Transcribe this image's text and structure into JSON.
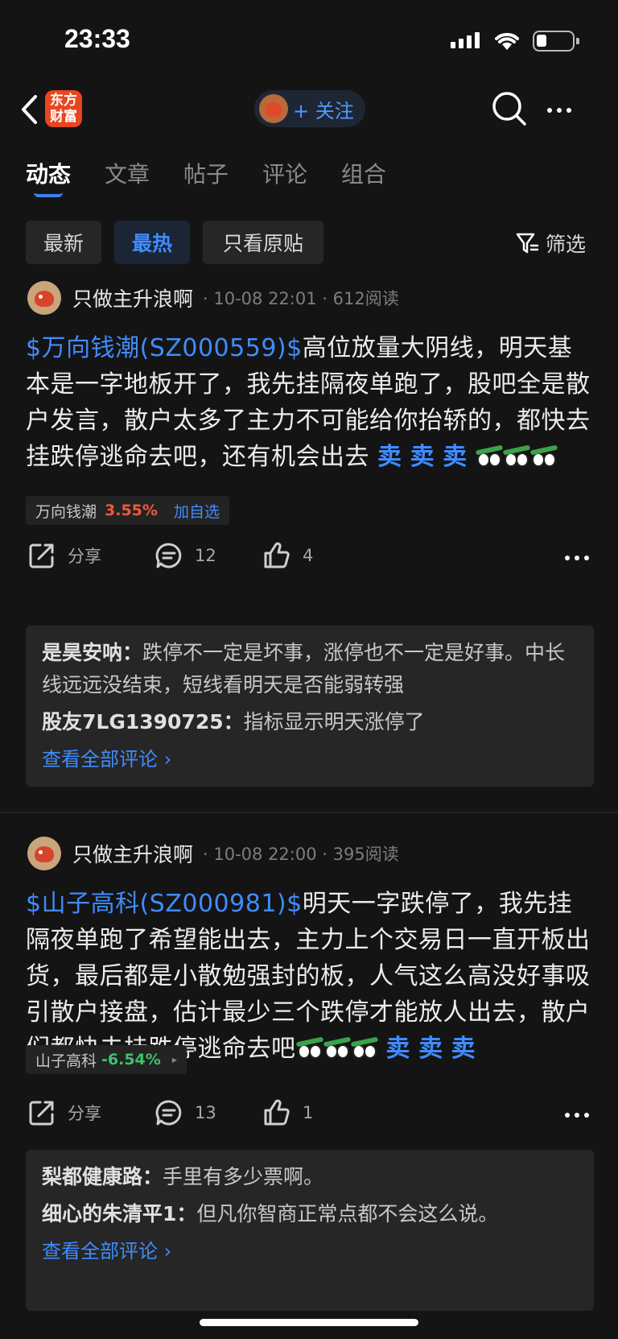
{
  "status": {
    "time": "23:33"
  },
  "nav": {
    "logo_line1": "东方",
    "logo_line2": "财富",
    "follow_label": "+ 关注"
  },
  "tabs": [
    "动态",
    "文章",
    "帖子",
    "评论",
    "组合"
  ],
  "filters": {
    "chips": [
      "最新",
      "最热",
      "只看原贴"
    ],
    "filter_label": "筛选"
  },
  "posts": [
    {
      "author": "只做主升浪啊",
      "time": "10-08 22:01",
      "reads": "612阅读",
      "stock_link": "$万向钱潮(SZ000559)$",
      "text": "高位放量大阴线，明天基本是一字地板开了，我先挂隔夜单跑了，股吧全是散户发言，散户太多了主力不可能给你抬轿的，都快去挂跌停逃命去吧，还有机会出去",
      "sell": "卖",
      "tag_name": "万向钱潮",
      "tag_pct": "3.55%",
      "tag_add": "加自选",
      "share": "分享",
      "comments_count": "12",
      "likes": "4",
      "comments": [
        {
          "user": "是昊安呐：",
          "text": "跌停不一定是坏事，涨停也不一定是好事。中长线远远没结束，短线看明天是否能弱转强"
        },
        {
          "user": "股友7LG1390725：",
          "text": "指标显示明天涨停了"
        }
      ],
      "view_all": "查看全部评论 ›"
    },
    {
      "author": "只做主升浪啊",
      "time": "10-08 22:00",
      "reads": "395阅读",
      "stock_link": "$山子高科(SZ000981)$",
      "text": "明天一字跌停了，我先挂隔夜单跑了希望能出去，主力上个交易日一直开板出货，最后都是小散勉强封的板，人气这么高没好事吸引散户接盘，估计最少三个跌停才能放人出去，散户们都快去挂跌停逃命去吧",
      "sell": "卖",
      "tag_name": "山子高科",
      "tag_pct": "-6.54%",
      "tag_arrow": "▸",
      "share": "分享",
      "comments_count": "13",
      "likes": "1",
      "comments": [
        {
          "user": "梨都健康路：",
          "text": "手里有多少票啊。"
        },
        {
          "user": "细心的朱清平1：",
          "text": "但凡你智商正常点都不会这么说。"
        }
      ],
      "view_all": "查看全部评论 ›"
    }
  ]
}
